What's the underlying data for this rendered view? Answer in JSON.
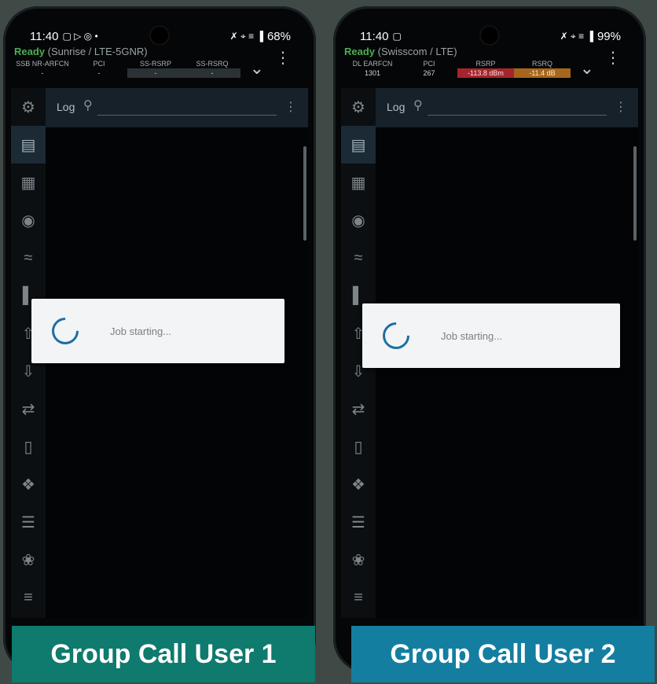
{
  "left": {
    "time": "11:40",
    "status_icons_left": "▢ ▷ ◎ •",
    "status_icons_right": "✗ ⌖ ≡ ▐",
    "battery": "68%",
    "ready": "Ready",
    "network": "(Sunrise / LTE-5GNR)",
    "columns": [
      {
        "label": "SSB NR-ARFCN",
        "value": "-"
      },
      {
        "label": "PCI",
        "value": "-"
      },
      {
        "label": "SS-RSRP",
        "value": "-"
      },
      {
        "label": "SS-RSRQ",
        "value": "-"
      }
    ],
    "tab": "Log",
    "dialog_text": "Job starting...",
    "caption": "Group Call User 1",
    "caption_color": "#0f7a6e"
  },
  "right": {
    "time": "11:40",
    "status_icons_left": "▢",
    "status_icons_right": "✗ ⌖ ≡ ▐",
    "battery": "99%",
    "ready": "Ready",
    "network": "(Swisscom / LTE)",
    "columns": [
      {
        "label": "DL EARFCN",
        "value": "1301"
      },
      {
        "label": "PCI",
        "value": "267"
      },
      {
        "label": "RSRP",
        "value": "-113.8 dBm"
      },
      {
        "label": "RSRQ",
        "value": "-11.4 dB"
      }
    ],
    "tab": "Log",
    "dialog_text": "Job starting...",
    "caption": "Group Call User 2",
    "caption_color": "#137ea0"
  },
  "sidebar_icons": [
    "gear-icon",
    "document-icon",
    "list-document-icon",
    "location-pin-icon",
    "signal-satellite-icon",
    "signal-bars-icon",
    "upload-icon",
    "download-icon",
    "transfer-arrows-icon",
    "phone-device-icon",
    "antenna-icon",
    "menu-lines-icon",
    "globe-icon",
    "checklist-icon",
    "call-icon"
  ]
}
